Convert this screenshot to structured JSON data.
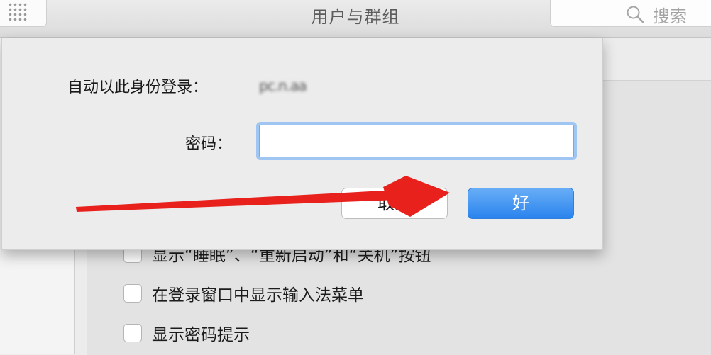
{
  "window": {
    "title": "用户与群组",
    "search_placeholder": "搜索"
  },
  "dialog": {
    "auto_login_label": "自动以此身份登录：",
    "auto_login_user": "pc.n.aa",
    "password_label": "密码：",
    "password_value": "",
    "cancel_label": "取消",
    "ok_label": "好"
  },
  "options": [
    {
      "label": "显示“睡眠”、“重新启动”和“关机”按钮",
      "checked": false
    },
    {
      "label": "在登录窗口中显示输入法菜单",
      "checked": false
    },
    {
      "label": "显示密码提示",
      "checked": false
    }
  ],
  "annotation": {
    "arrow_color": "#e8211d"
  }
}
